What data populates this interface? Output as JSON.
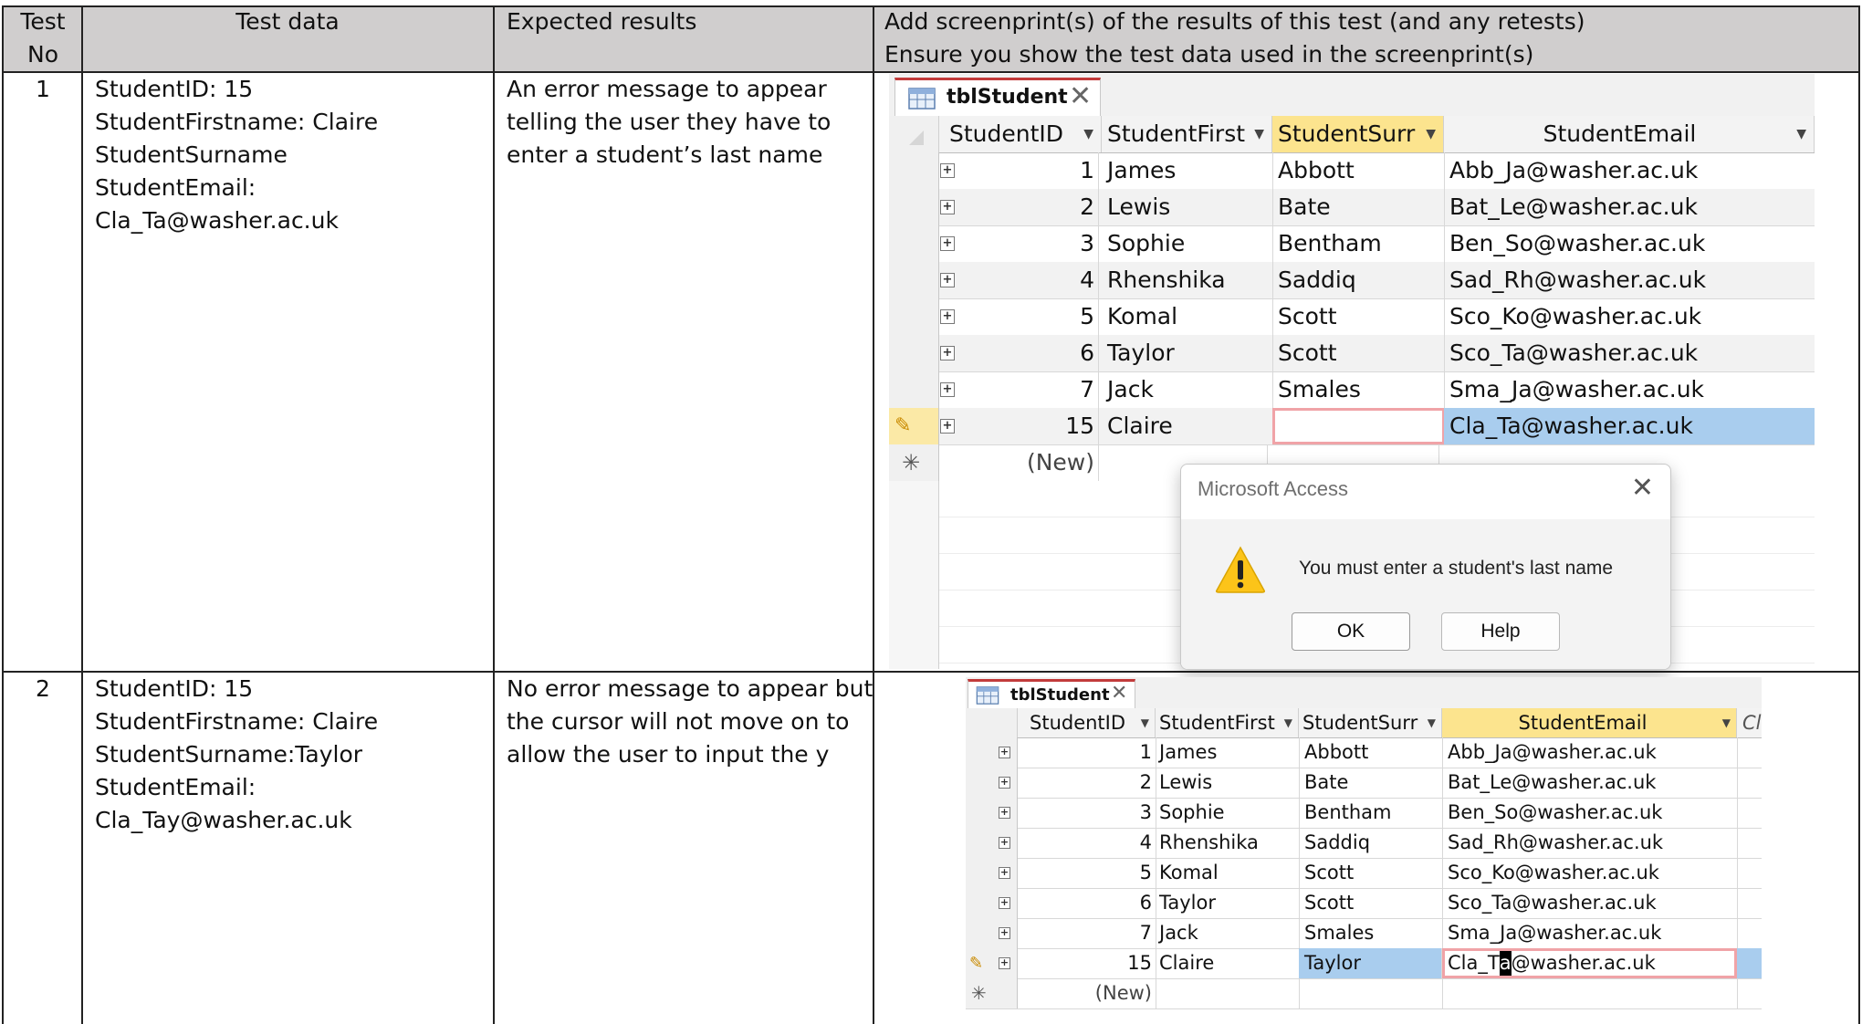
{
  "table": {
    "headers": {
      "test_no": "Test No",
      "test_data": "Test data",
      "expected": "Expected results",
      "screenprint_line1": "Add screenprint(s) of the results of this test (and any retests)",
      "screenprint_line2": "Ensure you show the test data used in the screenprint(s)"
    },
    "rows": [
      {
        "no": "1",
        "data_lines": [
          "StudentID: 15",
          "StudentFirstname: Claire",
          "StudentSurname",
          "StudentEmail:",
          "Cla_Ta@washer.ac.uk"
        ],
        "expected_lines": [
          "An error message to appear",
          "telling the user they have to",
          "enter a student’s last name"
        ]
      },
      {
        "no": "2",
        "data_lines": [
          "StudentID: 15",
          "StudentFirstname: Claire",
          "StudentSurname:Taylor",
          "StudentEmail:",
          "Cla_Tay@washer.ac.uk"
        ],
        "expected_lines": [
          "No error message to appear but",
          "the cursor will not move on to",
          "allow the user to input the y"
        ]
      }
    ]
  },
  "access": {
    "tab_label": "tblStudent",
    "columns": [
      "StudentID",
      "StudentFirst",
      "StudentSurr",
      "StudentEmail",
      "Cl"
    ],
    "records": [
      {
        "id": "1",
        "first": "James",
        "surname": "Abbott",
        "email": "Abb_Ja@washer.ac.uk"
      },
      {
        "id": "2",
        "first": "Lewis",
        "surname": "Bate",
        "email": "Bat_Le@washer.ac.uk"
      },
      {
        "id": "3",
        "first": "Sophie",
        "surname": "Bentham",
        "email": "Ben_So@washer.ac.uk"
      },
      {
        "id": "4",
        "first": "Rhenshika",
        "surname": "Saddiq",
        "email": "Sad_Rh@washer.ac.uk"
      },
      {
        "id": "5",
        "first": "Komal",
        "surname": "Scott",
        "email": "Sco_Ko@washer.ac.uk"
      },
      {
        "id": "6",
        "first": "Taylor",
        "surname": "Scott",
        "email": "Sco_Ta@washer.ac.uk"
      },
      {
        "id": "7",
        "first": "Jack",
        "surname": "Smales",
        "email": "Sma_Ja@washer.ac.uk"
      }
    ],
    "edit_row_1": {
      "id": "15",
      "first": "Claire",
      "surname": "",
      "email": "Cla_Ta@washer.ac.uk"
    },
    "edit_row_2": {
      "id": "15",
      "first": "Claire",
      "surname": "Taylor",
      "email_before": "Cla_T",
      "email_cursor": "a",
      "email_after": "@washer.ac.uk"
    },
    "new_row_label": "(New)"
  },
  "dialog": {
    "title": "Microsoft Access",
    "message": "You must enter a student's last name",
    "ok_label": "OK",
    "help_label": "Help",
    "icon": "warning-icon"
  },
  "colors": {
    "header_bg": "#d0cece",
    "selected_column": "#fce48e",
    "selected_row": "#a9cdee",
    "error_outline": "#f0a3a7",
    "tab_accent": "#c23b3b"
  }
}
